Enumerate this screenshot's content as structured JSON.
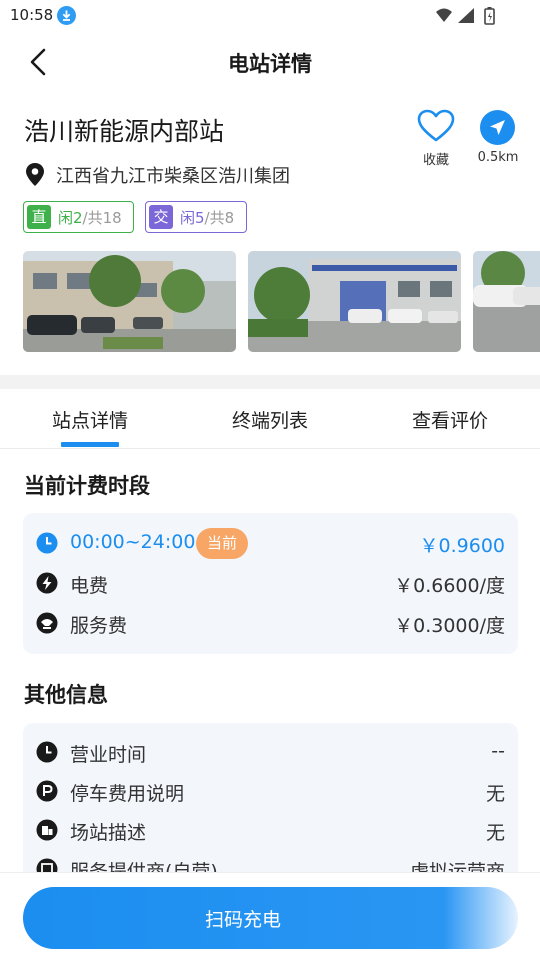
{
  "status_bar": {
    "time": "10:58"
  },
  "nav": {
    "title": "电站详情"
  },
  "station": {
    "name": "浩川新能源内部站",
    "address": "江西省九江市柴桑区浩川集团",
    "favorite_label": "收藏",
    "distance": "0.5km",
    "tags": [
      {
        "type": "直",
        "free": "闲2",
        "total": "/共18"
      },
      {
        "type": "交",
        "free": "闲5",
        "total": "/共8"
      }
    ]
  },
  "tabs": [
    {
      "label": "站点详情",
      "active": true
    },
    {
      "label": "终端列表",
      "active": false
    },
    {
      "label": "查看评价",
      "active": false
    }
  ],
  "pricing": {
    "title": "当前计费时段",
    "period": "00:00~24:00",
    "current_badge": "当前",
    "total_price": "￥0.9600",
    "rows": [
      {
        "label": "电费",
        "value": "￥0.6600/度",
        "icon": "bolt-icon"
      },
      {
        "label": "服务费",
        "value": "￥0.3000/度",
        "icon": "service-icon"
      }
    ]
  },
  "other_info": {
    "title": "其他信息",
    "rows": [
      {
        "label": "营业时间",
        "value": "--",
        "icon": "clock-icon"
      },
      {
        "label": "停车费用说明",
        "value": "无",
        "icon": "parking-icon"
      },
      {
        "label": "场站描述",
        "value": "无",
        "icon": "station-icon"
      },
      {
        "label": "服务提供商(自营)",
        "value": "虚拟运营商",
        "icon": "provider-icon"
      }
    ]
  },
  "bottom": {
    "scan_label": "扫码充电"
  },
  "colors": {
    "accent": "#1b8ef0",
    "dc_green": "#3fb14a",
    "ac_purple": "#7b67d8",
    "badge_orange": "#f7a665"
  }
}
